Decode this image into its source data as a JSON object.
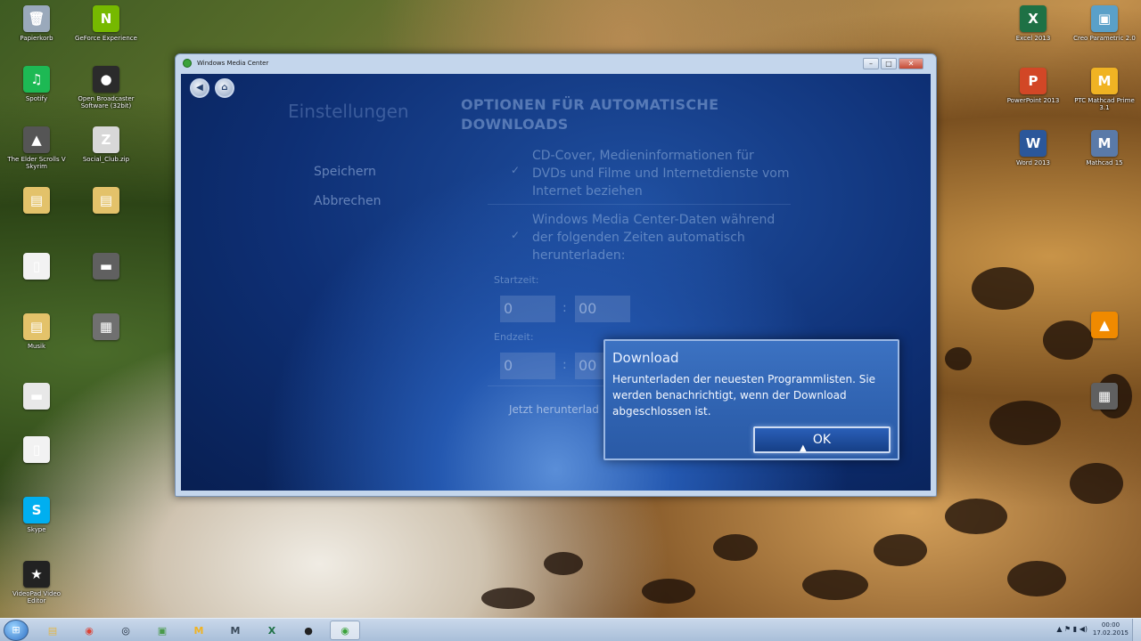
{
  "desktop": {
    "icons_left": [
      {
        "label": "Papierkorb",
        "glyph": "🗑",
        "color": "#9aa9bb"
      },
      {
        "label": "GeForce Experience",
        "glyph": "N",
        "color": "#76b900"
      },
      {
        "label": "Spotify",
        "glyph": "♫",
        "color": "#1db954"
      },
      {
        "label": "Open Broadcaster Software (32bit)",
        "glyph": "●",
        "color": "#2b2b2b"
      },
      {
        "label": "The Elder Scrolls V Skyrim",
        "glyph": "▲",
        "color": "#555555"
      },
      {
        "label": "Social_Club.zip",
        "glyph": "Z",
        "color": "#d8d8d8"
      },
      {
        "label": "",
        "glyph": "▤",
        "color": "#e3c26a"
      },
      {
        "label": "",
        "glyph": "▤",
        "color": "#e3c26a"
      },
      {
        "label": "",
        "glyph": "▯",
        "color": "#f2f2f2"
      },
      {
        "label": "",
        "glyph": "▬",
        "color": "#606060"
      },
      {
        "label": "Musik",
        "glyph": "▤",
        "color": "#e3c26a"
      },
      {
        "label": "",
        "glyph": "▦",
        "color": "#707070"
      },
      {
        "label": "",
        "glyph": "▬",
        "color": "#e8e8e8"
      },
      {
        "label": "",
        "glyph": "▯",
        "color": "#f2f2f2"
      },
      {
        "label": "Skype",
        "glyph": "S",
        "color": "#00aff0"
      },
      {
        "label": "VideoPad Video Editor",
        "glyph": "★",
        "color": "#222222"
      }
    ],
    "icons_right": [
      {
        "label": "Excel 2013",
        "glyph": "X",
        "color": "#1e7145"
      },
      {
        "label": "Creo Parametric 2.0",
        "glyph": "▣",
        "color": "#5aa0c8"
      },
      {
        "label": "PowerPoint 2013",
        "glyph": "P",
        "color": "#d24726"
      },
      {
        "label": "PTC Mathcad Prime 3.1",
        "glyph": "M",
        "color": "#f0b323"
      },
      {
        "label": "Word 2013",
        "glyph": "W",
        "color": "#2b579a"
      },
      {
        "label": "Mathcad 15",
        "glyph": "M",
        "color": "#5a7aa8"
      },
      {
        "label": "",
        "glyph": "▲",
        "color": "#f08a00"
      },
      {
        "label": "",
        "glyph": "▦",
        "color": "#606060"
      }
    ]
  },
  "window": {
    "title": "Windows Media Center",
    "minimize": "–",
    "maximize": "□",
    "close": "✕",
    "back_glyph": "◀",
    "home_glyph": "⌂"
  },
  "settings": {
    "section_title": "Einstellungen",
    "page_title": "OPTIONEN FÜR AUTOMATISCHE DOWNLOADS",
    "actions": {
      "save": "Speichern",
      "cancel": "Abbrechen"
    },
    "options": [
      {
        "checked": true,
        "check_glyph": "✓",
        "text": "CD-Cover, Medieninformationen für DVDs und Filme und Internetdienste vom Internet beziehen"
      },
      {
        "checked": true,
        "check_glyph": "✓",
        "text": "Windows Media Center-Daten während der folgenden Zeiten automatisch herunterladen:"
      }
    ],
    "start_label": "Startzeit:",
    "start_hour": "0",
    "start_minute": "00",
    "end_label": "Endzeit:",
    "end_hour": "0",
    "end_minute": "00",
    "time_separator": ":",
    "download_now": "Jetzt herunterlad"
  },
  "dialog": {
    "title": "Download",
    "message": "Herunterladen der neuesten Programmlisten. Sie werden benachrichtigt, wenn der Download abgeschlossen ist.",
    "ok_label": "OK"
  },
  "transport": {
    "buttons": [
      {
        "name": "record-button",
        "glyph": "●"
      },
      {
        "name": "stop-button",
        "glyph": "■"
      },
      {
        "name": "channel-minus-button",
        "glyph": "–"
      },
      {
        "name": "channel-plus-button",
        "glyph": "+"
      },
      {
        "name": "stop-square-button",
        "glyph": "■"
      },
      {
        "name": "rewind-button",
        "glyph": "◀◀"
      },
      {
        "name": "skip-back-button",
        "glyph": "|◀"
      },
      {
        "name": "play-button",
        "glyph": "▶"
      },
      {
        "name": "skip-forward-button",
        "glyph": "▶|"
      },
      {
        "name": "fast-forward-button",
        "glyph": "▶▶"
      },
      {
        "name": "mute-button",
        "glyph": "◀)"
      },
      {
        "name": "volume-down-button",
        "glyph": "–"
      },
      {
        "name": "volume-up-button",
        "glyph": "+"
      }
    ]
  },
  "taskbar": {
    "start_glyph": "⊞",
    "items": [
      {
        "name": "explorer",
        "glyph": "▤",
        "color": "#e3b64a",
        "active": false
      },
      {
        "name": "chrome",
        "glyph": "◉",
        "color": "#db4437",
        "active": false
      },
      {
        "name": "steam",
        "glyph": "◎",
        "color": "#1b2838",
        "active": false
      },
      {
        "name": "creo",
        "glyph": "▣",
        "color": "#4a9a4a",
        "active": false
      },
      {
        "name": "mathcad-prime",
        "glyph": "M",
        "color": "#f0b323",
        "active": false
      },
      {
        "name": "mathcad",
        "glyph": "M",
        "color": "#3a4a5a",
        "active": false
      },
      {
        "name": "excel",
        "glyph": "X",
        "color": "#1e7145",
        "active": false
      },
      {
        "name": "obs",
        "glyph": "●",
        "color": "#222222",
        "active": false
      },
      {
        "name": "media-center",
        "glyph": "◉",
        "color": "#3aa23a",
        "active": true
      }
    ],
    "tray_glyphs": "▲ ⚑ ▮ ◀)",
    "time": "00:00",
    "date": "17.02.2015"
  }
}
